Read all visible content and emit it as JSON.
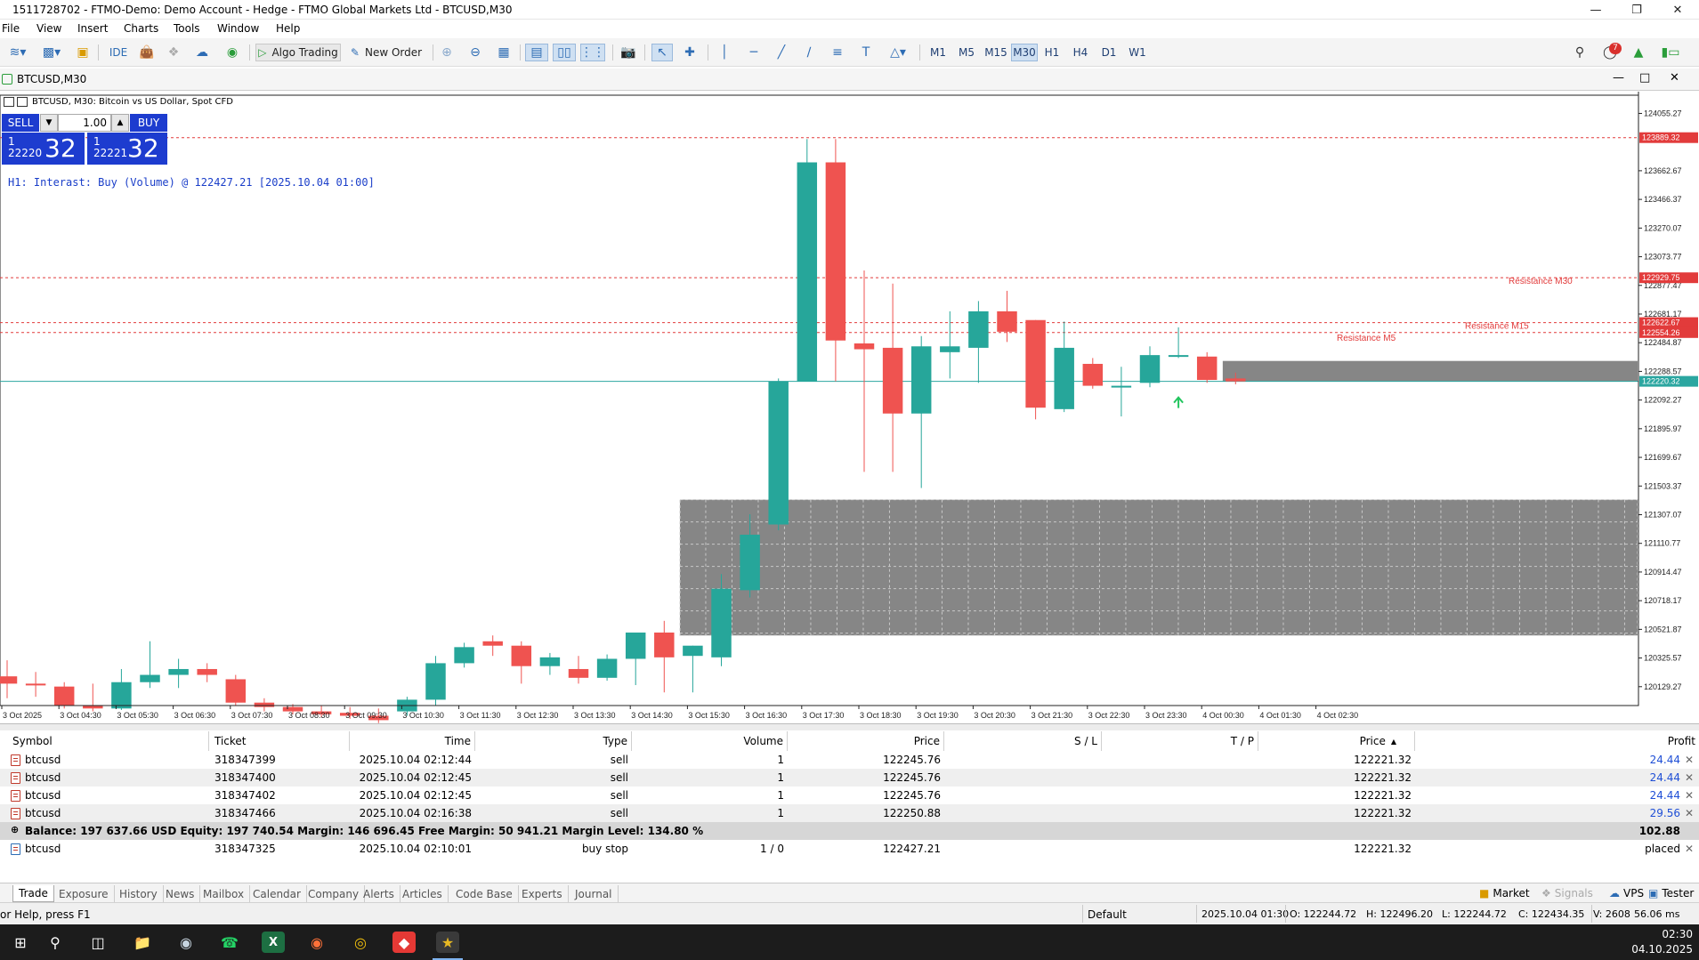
{
  "window": {
    "title": "1511728702 - FTMO-Demo: Demo Account - Hedge - FTMO Global Markets Ltd - BTCUSD,M30"
  },
  "menu": [
    "File",
    "View",
    "Insert",
    "Charts",
    "Tools",
    "Window",
    "Help"
  ],
  "toolbar": {
    "ide": "IDE",
    "algo_trading": "Algo Trading",
    "new_order": "New Order",
    "timeframes": [
      "M1",
      "M5",
      "M15",
      "M30",
      "H1",
      "H4",
      "D1",
      "W1"
    ],
    "active_timeframe": "M30",
    "notifications_count": "7"
  },
  "chart_window": {
    "title": "BTCUSD,M30",
    "info": "BTCUSD, M30:  Bitcoin vs US Dollar, Spot CFD"
  },
  "one_click": {
    "sell_label": "SELL",
    "buy_label": "BUY",
    "volume": "1.00",
    "sell_prefix": "1\n22220",
    "sell_big": "32",
    "buy_prefix": "1\n22221",
    "buy_big": "32"
  },
  "chart_comment": "H1: Interast: Buy (Volume) @ 122427.21 [2025.10.04 01:00]",
  "chart_data": {
    "type": "candlestick",
    "symbol": "BTCUSD",
    "timeframe": "M30",
    "ylim": [
      120000,
      124180
    ],
    "price_ticks": [
      "124055.27",
      "123662.67",
      "123466.37",
      "123270.07",
      "123073.77",
      "122877.47",
      "122681.17",
      "122484.87",
      "122288.57",
      "122092.27",
      "121895.97",
      "121699.67",
      "121503.37",
      "121307.07",
      "121110.77",
      "120914.47",
      "120718.17",
      "120521.87",
      "120325.57",
      "120129.27"
    ],
    "time_labels": [
      "3 Oct 2025",
      "3 Oct 04:30",
      "3 Oct 05:30",
      "3 Oct 06:30",
      "3 Oct 07:30",
      "3 Oct 08:30",
      "3 Oct 09:30",
      "3 Oct 10:30",
      "3 Oct 11:30",
      "3 Oct 12:30",
      "3 Oct 13:30",
      "3 Oct 14:30",
      "3 Oct 15:30",
      "3 Oct 16:30",
      "3 Oct 17:30",
      "3 Oct 18:30",
      "3 Oct 19:30",
      "3 Oct 20:30",
      "3 Oct 21:30",
      "3 Oct 22:30",
      "3 Oct 23:30",
      "4 Oct 00:30",
      "4 Oct 01:30",
      "4 Oct 02:30"
    ],
    "candles": [
      {
        "o": 120200,
        "h": 120310,
        "c": 120150,
        "l": 120050
      },
      {
        "o": 120150,
        "h": 120230,
        "c": 120140,
        "l": 120060
      },
      {
        "o": 120130,
        "h": 120160,
        "c": 120000,
        "l": 119980
      },
      {
        "o": 120000,
        "h": 120150,
        "c": 119980,
        "l": 119960
      },
      {
        "o": 119980,
        "h": 120250,
        "c": 120160,
        "l": 119970
      },
      {
        "o": 120160,
        "h": 120440,
        "c": 120210,
        "l": 120120
      },
      {
        "o": 120210,
        "h": 120320,
        "c": 120250,
        "l": 120120
      },
      {
        "o": 120250,
        "h": 120290,
        "c": 120210,
        "l": 120160
      },
      {
        "o": 120180,
        "h": 120210,
        "c": 120020,
        "l": 120000
      },
      {
        "o": 120020,
        "h": 120050,
        "c": 119990,
        "l": 119960
      },
      {
        "o": 119990,
        "h": 120010,
        "c": 119960,
        "l": 119940
      },
      {
        "o": 119960,
        "h": 120000,
        "c": 119940,
        "l": 119920
      },
      {
        "o": 119950,
        "h": 119990,
        "c": 119930,
        "l": 119910
      },
      {
        "o": 119930,
        "h": 119980,
        "c": 119900,
        "l": 119880
      },
      {
        "o": 119960,
        "h": 120060,
        "c": 120040,
        "l": 119930
      },
      {
        "o": 120040,
        "h": 120340,
        "c": 120290,
        "l": 120000
      },
      {
        "o": 120290,
        "h": 120430,
        "c": 120400,
        "l": 120260
      },
      {
        "o": 120440,
        "h": 120480,
        "c": 120410,
        "l": 120340
      },
      {
        "o": 120410,
        "h": 120440,
        "c": 120270,
        "l": 120150
      },
      {
        "o": 120270,
        "h": 120360,
        "c": 120330,
        "l": 120210
      },
      {
        "o": 120250,
        "h": 120340,
        "c": 120190,
        "l": 120150
      },
      {
        "o": 120190,
        "h": 120350,
        "c": 120320,
        "l": 120170
      },
      {
        "o": 120320,
        "h": 120490,
        "c": 120500,
        "l": 120140
      },
      {
        "o": 120500,
        "h": 120580,
        "c": 120330,
        "l": 120090
      },
      {
        "o": 120340,
        "h": 120410,
        "c": 120410,
        "l": 120090
      },
      {
        "o": 120330,
        "h": 120900,
        "c": 120800,
        "l": 120270
      },
      {
        "o": 120790,
        "h": 121310,
        "c": 121170,
        "l": 120740
      },
      {
        "o": 121240,
        "h": 122240,
        "c": 122220,
        "l": 121200
      },
      {
        "o": 122220,
        "h": 123880,
        "c": 123720,
        "l": 122220
      },
      {
        "o": 123720,
        "h": 123880,
        "c": 122500,
        "l": 122220
      },
      {
        "o": 122480,
        "h": 122980,
        "c": 122440,
        "l": 121600
      },
      {
        "o": 122450,
        "h": 122890,
        "c": 122000,
        "l": 121600
      },
      {
        "o": 122000,
        "h": 122530,
        "c": 122460,
        "l": 121490
      },
      {
        "o": 122420,
        "h": 122700,
        "c": 122460,
        "l": 122240
      },
      {
        "o": 122450,
        "h": 122770,
        "c": 122700,
        "l": 122210
      },
      {
        "o": 122700,
        "h": 122840,
        "c": 122560,
        "l": 122490
      },
      {
        "o": 122640,
        "h": 122640,
        "c": 122040,
        "l": 121960
      },
      {
        "o": 122030,
        "h": 122630,
        "c": 122450,
        "l": 122010
      },
      {
        "o": 122340,
        "h": 122380,
        "c": 122190,
        "l": 122170
      },
      {
        "o": 122190,
        "h": 122320,
        "c": 122190,
        "l": 121980
      },
      {
        "o": 122210,
        "h": 122460,
        "c": 122400,
        "l": 122180
      },
      {
        "o": 122400,
        "h": 122590,
        "c": 122400,
        "l": 122380
      },
      {
        "o": 122390,
        "h": 122420,
        "c": 122230,
        "l": 122210
      },
      {
        "o": 122240,
        "h": 122280,
        "c": 122220,
        "l": 122200
      }
    ],
    "horizontal_levels": [
      {
        "price": 123889.32,
        "label": "123889.32",
        "style": "dashed",
        "color": "#e23b3b"
      },
      {
        "price": 122929.75,
        "label": "122929.75",
        "name": "Resistance M30",
        "style": "dashed",
        "color": "#e23b3b"
      },
      {
        "price": 122622.67,
        "label": "122622.67",
        "name": "Resistance M15",
        "style": "dashed",
        "color": "#e23b3b"
      },
      {
        "price": 122554.26,
        "label": "122554.26",
        "name": "Resistance M5",
        "style": "dashed",
        "color": "#e23b3b"
      },
      {
        "price": 122220.32,
        "label": "122220.32",
        "style": "solid",
        "color": "#2ba6a0"
      }
    ],
    "zones": [
      {
        "from_index": 24,
        "top": 121410,
        "bottom": 120480
      },
      {
        "from_index": 43,
        "top": 122360,
        "bottom": 122220
      }
    ],
    "colors": {
      "bull": "#26a69a",
      "bear": "#ef5350",
      "zone": "#7f7f7f",
      "bg": "#ffffff"
    },
    "grid": true
  },
  "trade_table": {
    "columns": [
      "Symbol",
      "Ticket",
      "Time",
      "Type",
      "Volume",
      "Price",
      "S / L",
      "T / P",
      "Price",
      "Profit"
    ],
    "rows": [
      {
        "symbol": "btcusd",
        "ticket": "318347399",
        "time": "2025.10.04 02:12:44",
        "type": "sell",
        "volume": "1",
        "price": "122245.76",
        "sl": "",
        "tp": "",
        "cur_price": "122221.32",
        "profit": "24.44"
      },
      {
        "symbol": "btcusd",
        "ticket": "318347400",
        "time": "2025.10.04 02:12:45",
        "type": "sell",
        "volume": "1",
        "price": "122245.76",
        "sl": "",
        "tp": "",
        "cur_price": "122221.32",
        "profit": "24.44"
      },
      {
        "symbol": "btcusd",
        "ticket": "318347402",
        "time": "2025.10.04 02:12:45",
        "type": "sell",
        "volume": "1",
        "price": "122245.76",
        "sl": "",
        "tp": "",
        "cur_price": "122221.32",
        "profit": "24.44"
      },
      {
        "symbol": "btcusd",
        "ticket": "318347466",
        "time": "2025.10.04 02:16:38",
        "type": "sell",
        "volume": "1",
        "price": "122250.88",
        "sl": "",
        "tp": "",
        "cur_price": "122221.32",
        "profit": "29.56"
      }
    ],
    "balance_line": "Balance: 197 637.66 USD  Equity: 197 740.54  Margin: 146 696.45  Free Margin: 50 941.21  Margin Level: 134.80 %",
    "total_profit": "102.88",
    "pending": {
      "symbol": "btcusd",
      "ticket": "318347325",
      "time": "2025.10.04 02:10:01",
      "type": "buy stop",
      "volume": "1 / 0",
      "price": "122427.21",
      "cur_price": "122221.32",
      "status": "placed"
    }
  },
  "tabs": [
    "Trade",
    "Exposure",
    "History",
    "News",
    "Mailbox",
    "Calendar",
    "Company",
    "Alerts",
    "Articles",
    "Code Base",
    "Experts",
    "Journal"
  ],
  "tabs_right": {
    "market": "Market",
    "signals": "Signals",
    "vps": "VPS",
    "tester": "Tester"
  },
  "status": {
    "help": "or Help, press F1",
    "profile": "Default",
    "datetime": "2025.10.04 01:30",
    "open": "O: 122244.72",
    "high": "H: 122496.20",
    "low": "L: 122244.72",
    "close": "C: 122434.35",
    "volume": "V: 2608",
    "ping": "56.06 ms"
  },
  "taskbar": {
    "time": "02:30",
    "date": "04.10.2025"
  }
}
